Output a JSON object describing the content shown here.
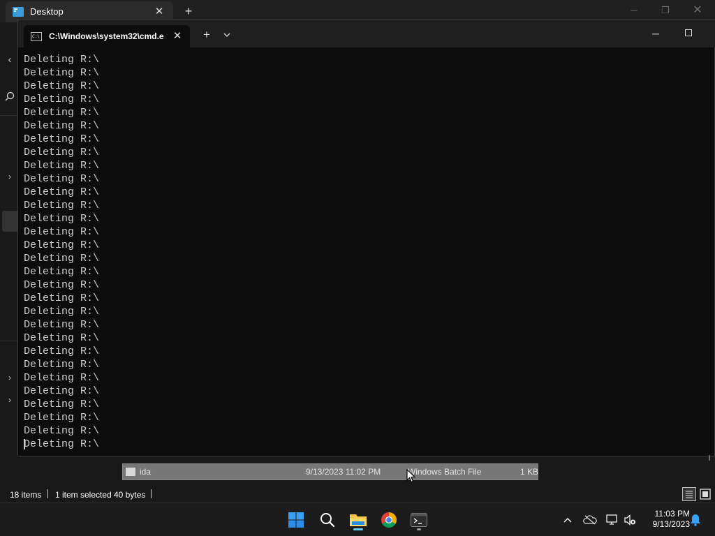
{
  "explorer": {
    "tab_title": "Desktop",
    "file_row": {
      "name": "ida",
      "date_modified": "9/13/2023 11:02 PM",
      "type": "Windows Batch File",
      "size": "1 KB"
    },
    "status": {
      "item_count": "18 items",
      "selection": "1 item selected",
      "selection_size": "40 bytes"
    }
  },
  "terminal": {
    "tab_title": "C:\\Windows\\system32\\cmd.e:",
    "lines": [
      "Deleting R:\\",
      "Deleting R:\\",
      "Deleting R:\\",
      "Deleting R:\\",
      "Deleting R:\\",
      "Deleting R:\\",
      "Deleting R:\\",
      "Deleting R:\\",
      "Deleting R:\\",
      "Deleting R:\\",
      "Deleting R:\\",
      "Deleting R:\\",
      "Deleting R:\\",
      "Deleting R:\\",
      "Deleting R:\\",
      "Deleting R:\\",
      "Deleting R:\\",
      "Deleting R:\\",
      "Deleting R:\\",
      "Deleting R:\\",
      "Deleting R:\\",
      "Deleting R:\\",
      "Deleting R:\\",
      "Deleting R:\\",
      "Deleting R:\\",
      "Deleting R:\\",
      "Deleting R:\\",
      "Deleting R:\\",
      "Deleting R:\\",
      "Deleting R:\\"
    ]
  },
  "taskbar": {
    "time": "11:03 PM",
    "date": "9/13/2023",
    "pinned": [
      "start-icon",
      "search-icon",
      "file-explorer-icon",
      "chrome-icon",
      "terminal-icon"
    ],
    "tray": [
      "chevron-up-icon",
      "onedrive-off-icon",
      "network-icon",
      "volume-muted-icon",
      "notification-bell-icon"
    ]
  },
  "colors": {
    "terminal_bg": "#0c0c0c",
    "terminal_text": "#cccccc",
    "accent": "#60cdff"
  }
}
